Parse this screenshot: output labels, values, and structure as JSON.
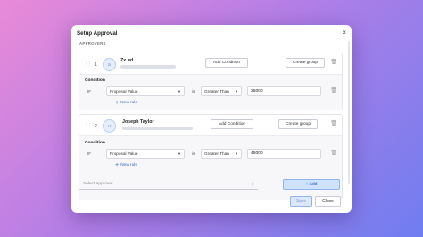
{
  "modal": {
    "title": "Setup Approval",
    "close_glyph": "×",
    "section_label": "APPROVERS"
  },
  "approvers": [
    {
      "index": "1",
      "initials": "ZI",
      "name": "Zx        ud",
      "add_condition_label": "Add Condition",
      "create_group_label": "Create group",
      "condition_title": "Condition",
      "if_label": "IF",
      "field": "Proposal Value",
      "is_label": "is",
      "operator": "Greater Than",
      "value": "25000",
      "new_rule_label": "New rule"
    },
    {
      "index": "2",
      "initials": "JT",
      "name": "Joseph Taylor",
      "add_condition_label": "Add Condition",
      "create_group_label": "Create group",
      "condition_title": "Condition",
      "if_label": "IF",
      "field": "Proposal Value",
      "is_label": "is",
      "operator": "Greater Than",
      "value": "45000",
      "new_rule_label": "New rule"
    }
  ],
  "select_approver": {
    "placeholder": "Select approver"
  },
  "add_button_label": "+ Add",
  "footer": {
    "save_label": "Save",
    "close_label": "Close"
  },
  "icons": {
    "trash": "trash-icon",
    "drag": "drag-handle-icon",
    "caret": "chevron-down-icon"
  }
}
